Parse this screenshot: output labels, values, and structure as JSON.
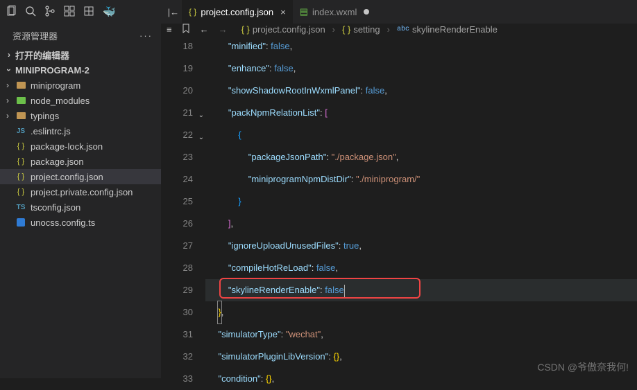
{
  "sidebar": {
    "title": "资源管理器",
    "open_editors_label": "打开的编辑器",
    "project_label": "MINIPROGRAM-2",
    "tree": [
      {
        "label": "miniprogram",
        "type": "folder",
        "icon": "folder"
      },
      {
        "label": "node_modules",
        "type": "folder",
        "icon": "green"
      },
      {
        "label": "typings",
        "type": "folder",
        "icon": "folder"
      },
      {
        "label": ".eslintrc.js",
        "type": "file",
        "icon": "js"
      },
      {
        "label": "package-lock.json",
        "type": "file",
        "icon": "json"
      },
      {
        "label": "package.json",
        "type": "file",
        "icon": "json"
      },
      {
        "label": "project.config.json",
        "type": "file",
        "icon": "json",
        "active": true
      },
      {
        "label": "project.private.config.json",
        "type": "file",
        "icon": "json"
      },
      {
        "label": "tsconfig.json",
        "type": "file",
        "icon": "ts"
      },
      {
        "label": "unocss.config.ts",
        "type": "file",
        "icon": "uno"
      }
    ]
  },
  "tabs": [
    {
      "label": "project.config.json",
      "active": true,
      "icon": "json",
      "dirty": false
    },
    {
      "label": "index.wxml",
      "active": false,
      "icon": "wxml",
      "dirty": true
    }
  ],
  "breadcrumbs": [
    "project.config.json",
    "setting",
    "skylineRenderEnable"
  ],
  "lines": {
    "start": 18,
    "count": 16
  },
  "code": {
    "l18": {
      "indent": "        ",
      "key": "\"minified\"",
      "val": "false",
      "trail": ","
    },
    "l19": {
      "indent": "        ",
      "key": "\"enhance\"",
      "val": "false",
      "trail": ","
    },
    "l20": {
      "indent": "        ",
      "key": "\"showShadowRootInWxmlPanel\"",
      "val": "false",
      "trail": ","
    },
    "l21": {
      "indent": "        ",
      "key": "\"packNpmRelationList\"",
      "open": "["
    },
    "l22": {
      "indent": "            ",
      "open": "{"
    },
    "l23": {
      "indent": "                ",
      "key": "\"packageJsonPath\"",
      "str": "\"./package.json\"",
      "trail": ","
    },
    "l24": {
      "indent": "                ",
      "key": "\"miniprogramNpmDistDir\"",
      "str": "\"./miniprogram/\""
    },
    "l25": {
      "indent": "            ",
      "close": "}"
    },
    "l26": {
      "indent": "        ",
      "close": "]",
      "trail": ","
    },
    "l27": {
      "indent": "        ",
      "key": "\"ignoreUploadUnusedFiles\"",
      "val": "true",
      "trail": ","
    },
    "l28": {
      "indent": "        ",
      "key": "\"compileHotReLoad\"",
      "val": "false",
      "trail": ","
    },
    "l29": {
      "indent": "        ",
      "key": "\"skylineRenderEnable\"",
      "val": "false"
    },
    "l30": {
      "indent": "    ",
      "close": "}",
      "trail": ","
    },
    "l31": {
      "indent": "    ",
      "key": "\"simulatorType\"",
      "str": "\"wechat\"",
      "trail": ","
    },
    "l32": {
      "indent": "    ",
      "key": "\"simulatorPluginLibVersion\"",
      "obj": "{}",
      "trail": ","
    },
    "l33": {
      "indent": "    ",
      "key": "\"condition\"",
      "obj": "{}",
      "trail": ","
    }
  },
  "watermark": "CSDN @爷傲奈我何!"
}
